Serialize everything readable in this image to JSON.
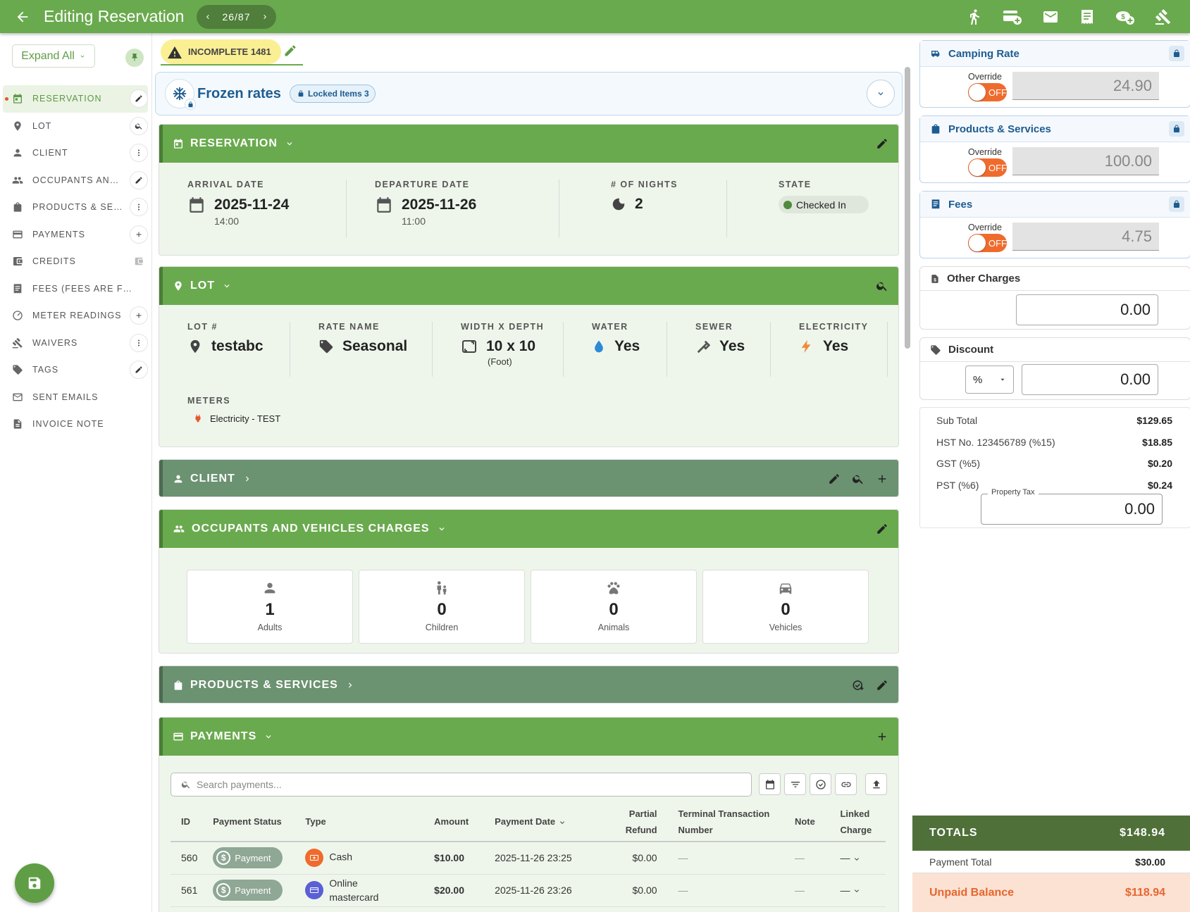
{
  "header": {
    "title": "Editing Reservation",
    "pager": "26/87"
  },
  "sidebar": {
    "expand_label": "Expand All",
    "items": [
      {
        "label": "RESERVATION"
      },
      {
        "label": "LOT"
      },
      {
        "label": "CLIENT"
      },
      {
        "label": "OCCUPANTS AND ..."
      },
      {
        "label": "PRODUCTS & SER..."
      },
      {
        "label": "PAYMENTS"
      },
      {
        "label": "CREDITS"
      },
      {
        "label": "FEES (FEES ARE FROZE..."
      },
      {
        "label": "METER READINGS"
      },
      {
        "label": "WAIVERS"
      },
      {
        "label": "TAGS"
      },
      {
        "label": "SENT EMAILS"
      },
      {
        "label": "INVOICE NOTE"
      }
    ]
  },
  "status": {
    "label": "INCOMPLETE 1481"
  },
  "frozen": {
    "title": "Frozen rates",
    "badge": "Locked Items 3"
  },
  "reservation": {
    "title": "RESERVATION",
    "arrival_label": "ARRIVAL DATE",
    "arrival_date": "2025-11-24",
    "arrival_time": "14:00",
    "departure_label": "DEPARTURE DATE",
    "departure_date": "2025-11-26",
    "departure_time": "11:00",
    "nights_label": "# OF NIGHTS",
    "nights": "2",
    "state_label": "STATE",
    "state": "Checked In"
  },
  "lot": {
    "title": "LOT",
    "lot_label": "LOT #",
    "lot": "testabc",
    "rate_label": "RATE NAME",
    "rate": "Seasonal",
    "size_label": "WIDTH X DEPTH",
    "size": "10 x 10",
    "size_unit": "(Foot)",
    "water_label": "WATER",
    "water": "Yes",
    "sewer_label": "SEWER",
    "sewer": "Yes",
    "electricity_label": "ELECTRICITY",
    "electricity": "Yes",
    "meters_label": "METERS",
    "meter": "Electricity - TEST"
  },
  "client": {
    "title": "CLIENT"
  },
  "occupants": {
    "title": "OCCUPANTS AND VEHICLES CHARGES",
    "adults": "1",
    "adults_label": "Adults",
    "children": "0",
    "children_label": "Children",
    "animals": "0",
    "animals_label": "Animals",
    "vehicles": "0",
    "vehicles_label": "Vehicles"
  },
  "products": {
    "title": "PRODUCTS & SERVICES"
  },
  "payments": {
    "title": "PAYMENTS",
    "search_placeholder": "Search payments...",
    "columns": {
      "id": "ID",
      "status": "Payment Status",
      "type": "Type",
      "amount": "Amount",
      "date": "Payment Date",
      "partial_1": "Partial",
      "partial_2": "Refund",
      "terminal_1": "Terminal Transaction",
      "terminal_2": "Number",
      "note": "Note",
      "linked_1": "Linked",
      "linked_2": "Charge"
    },
    "rows": [
      {
        "id": "560",
        "status": "Payment",
        "type": "Cash",
        "amount": "$10.00",
        "date": "2025-11-26 23:25",
        "refund": "$0.00",
        "terminal": "—",
        "note": "—",
        "linked": "—"
      },
      {
        "id": "561",
        "status": "Payment",
        "type": "Online mastercard",
        "amount": "$20.00",
        "date": "2025-11-26 23:26",
        "refund": "$0.00",
        "terminal": "—",
        "note": "—",
        "linked": "—"
      }
    ]
  },
  "rates": {
    "override_label": "Override",
    "toggle_text": "OFF",
    "camping_title": "Camping Rate",
    "camping_value": "24.90",
    "products_title": "Products & Services",
    "products_value": "100.00",
    "fees_title": "Fees",
    "fees_value": "4.75"
  },
  "other_charges": {
    "title": "Other Charges",
    "value": "0.00"
  },
  "discount": {
    "title": "Discount",
    "unit": "%",
    "value": "0.00"
  },
  "summary": {
    "subtotal_label": "Sub Total",
    "subtotal": "$129.65",
    "hst_label": "HST No. 123456789 (%15)",
    "hst": "$18.85",
    "gst_label": "GST (%5)",
    "gst": "$0.20",
    "pst_label": "PST (%6)",
    "pst": "$0.24",
    "property_tax_label": "Property Tax",
    "property_tax": "0.00"
  },
  "totals": {
    "totals_label": "TOTALS",
    "totals": "$148.94",
    "payment_total_label": "Payment Total",
    "payment_total": "$30.00",
    "unpaid_label": "Unpaid Balance",
    "unpaid": "$118.94"
  },
  "colors": {
    "primary": "#6aaa4e",
    "accent_orange": "#ef6b2d",
    "blue": "#1d5c91"
  }
}
